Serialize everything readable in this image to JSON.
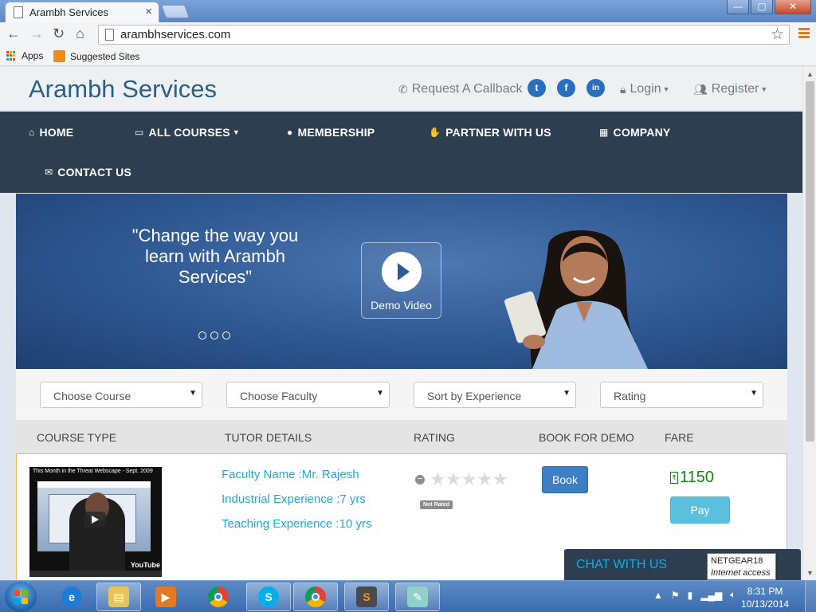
{
  "browser": {
    "tab_title": "Arambh Services",
    "tab_close": "×",
    "url": "arambhservices.com",
    "bookmarks": [
      {
        "label": "Apps"
      },
      {
        "label": "Suggested Sites"
      }
    ],
    "window_controls": {
      "minimize": "—",
      "maximize": "▢",
      "close": "✕"
    }
  },
  "site": {
    "brand": "Arambh Services",
    "header": {
      "callback": "Request A Callback",
      "login": "Login",
      "register": "Register",
      "social": [
        {
          "name": "twitter-icon",
          "glyph": "t"
        },
        {
          "name": "facebook-icon",
          "glyph": "f"
        },
        {
          "name": "linkedin-icon",
          "glyph": "in"
        }
      ]
    },
    "nav": [
      {
        "label": "HOME",
        "icon": "home-icon",
        "glyph": "⌂"
      },
      {
        "label": "ALL COURSES",
        "icon": "card-icon",
        "glyph": "▭"
      },
      {
        "label": "MEMBERSHIP",
        "icon": "user-icon",
        "glyph": "●"
      },
      {
        "label": "PARTNER WITH US",
        "icon": "thumbs-up-icon",
        "glyph": "✋"
      },
      {
        "label": "COMPANY",
        "icon": "building-icon",
        "glyph": "▦"
      },
      {
        "label": "CONTACT US",
        "icon": "envelope-icon",
        "glyph": "✉"
      }
    ],
    "hero": {
      "quote": "\"Change the way you learn with Arambh Services\"",
      "demo_label": "Demo Video"
    },
    "filters": [
      {
        "label": "Choose Course"
      },
      {
        "label": "Choose Faculty"
      },
      {
        "label": "Sort by Experience"
      },
      {
        "label": "Rating"
      }
    ],
    "table": {
      "headers": [
        "COURSE TYPE",
        "TUTOR DETAILS",
        "RATING",
        "BOOK FOR DEMO",
        "FARE"
      ],
      "rows": [
        {
          "video_title": "This Month in the Threat Webscape - Sept. 2009",
          "video_brand": "YouTube",
          "faculty": "Faculty Name :Mr. Rajesh",
          "industrial": "Industrial Experience :7 yrs",
          "teaching": "Teaching Experience :10 yrs",
          "stars": "★★★★★",
          "rating_badge": "Not Rated",
          "book_label": "Book",
          "fare": "1150",
          "pay_label": "Pay"
        }
      ]
    },
    "chat_label": "CHAT WITH US"
  },
  "network_tooltip": {
    "name": "NETGEAR18",
    "status": "Internet access"
  },
  "taskbar": {
    "time": "8:31 PM",
    "date": "10/13/2014"
  },
  "colors": {
    "brand": "#2b5f85",
    "nav_bg": "#2c3e50",
    "accent_link": "#1ea8dd",
    "book_btn": "#3d7fc4",
    "pay_btn": "#5bc0de",
    "fare": "#1a7f19"
  }
}
